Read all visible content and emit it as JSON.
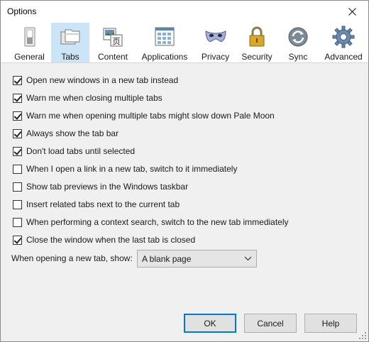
{
  "window": {
    "title": "Options"
  },
  "toolbar": {
    "tabs": [
      {
        "label": "General",
        "icon": "switch-icon"
      },
      {
        "label": "Tabs",
        "icon": "folders-icon",
        "selected": true
      },
      {
        "label": "Content",
        "icon": "content-icon"
      },
      {
        "label": "Applications",
        "icon": "applications-icon"
      },
      {
        "label": "Privacy",
        "icon": "mask-icon"
      },
      {
        "label": "Security",
        "icon": "padlock-icon"
      },
      {
        "label": "Sync",
        "icon": "sync-icon"
      },
      {
        "label": "Advanced",
        "icon": "gear-icon"
      }
    ]
  },
  "options": [
    {
      "label": "Open new windows in a new tab instead",
      "checked": true
    },
    {
      "label": "Warn me when closing multiple tabs",
      "checked": true
    },
    {
      "label": "Warn me when opening multiple tabs might slow down Pale Moon",
      "checked": true
    },
    {
      "label": "Always show the tab bar",
      "checked": true
    },
    {
      "label": "Don't load tabs until selected",
      "checked": true
    },
    {
      "label": "When I open a link in a new tab, switch to it immediately",
      "checked": false
    },
    {
      "label": "Show tab previews in the Windows taskbar",
      "checked": false
    },
    {
      "label": "Insert related tabs next to the current tab",
      "checked": false
    },
    {
      "label": "When performing a context search, switch to the new tab immediately",
      "checked": false
    },
    {
      "label": "Close the window when the last tab is closed",
      "checked": true
    }
  ],
  "newtab": {
    "label": "When opening a new tab, show:",
    "value": "A blank page"
  },
  "buttons": {
    "ok": "OK",
    "cancel": "Cancel",
    "help": "Help"
  },
  "colors": {
    "selected_tab": "#cce4f7",
    "default_button_border": "#0078d7"
  }
}
